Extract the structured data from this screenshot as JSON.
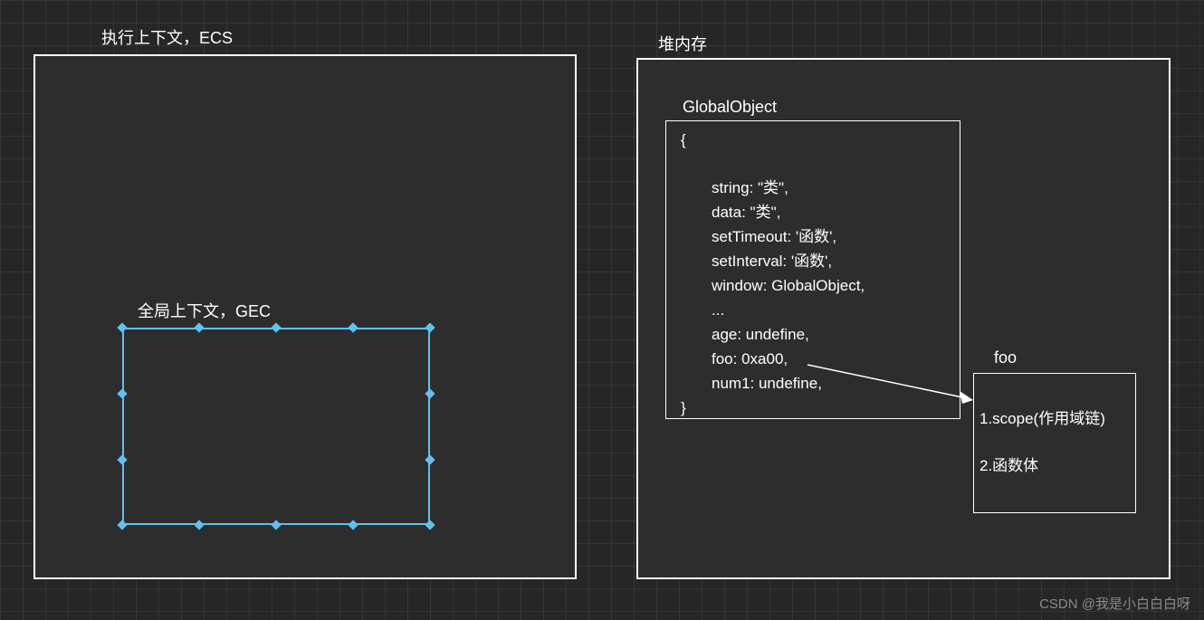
{
  "ecs": {
    "title": "执行上下文，ECS",
    "gec_title": "全局上下文，GEC"
  },
  "heap": {
    "title": "堆内存",
    "globalObject": {
      "title": "GlobalObject",
      "open": "{",
      "prop1": "string: \"类\",",
      "prop2": "data: \"类\",",
      "prop3": "setTimeout: '函数',",
      "prop4": "setInterval: '函数',",
      "prop5": "window: GlobalObject,",
      "prop6": "...",
      "prop7": "age: undefine,",
      "prop8": "foo: 0xa00,",
      "prop9": "num1: undefine,",
      "close": "}"
    },
    "foo": {
      "title": "foo",
      "line1": "1.scope(作用域链)",
      "line2": "2.函数体"
    }
  },
  "watermark": "CSDN @我是小白白白呀"
}
